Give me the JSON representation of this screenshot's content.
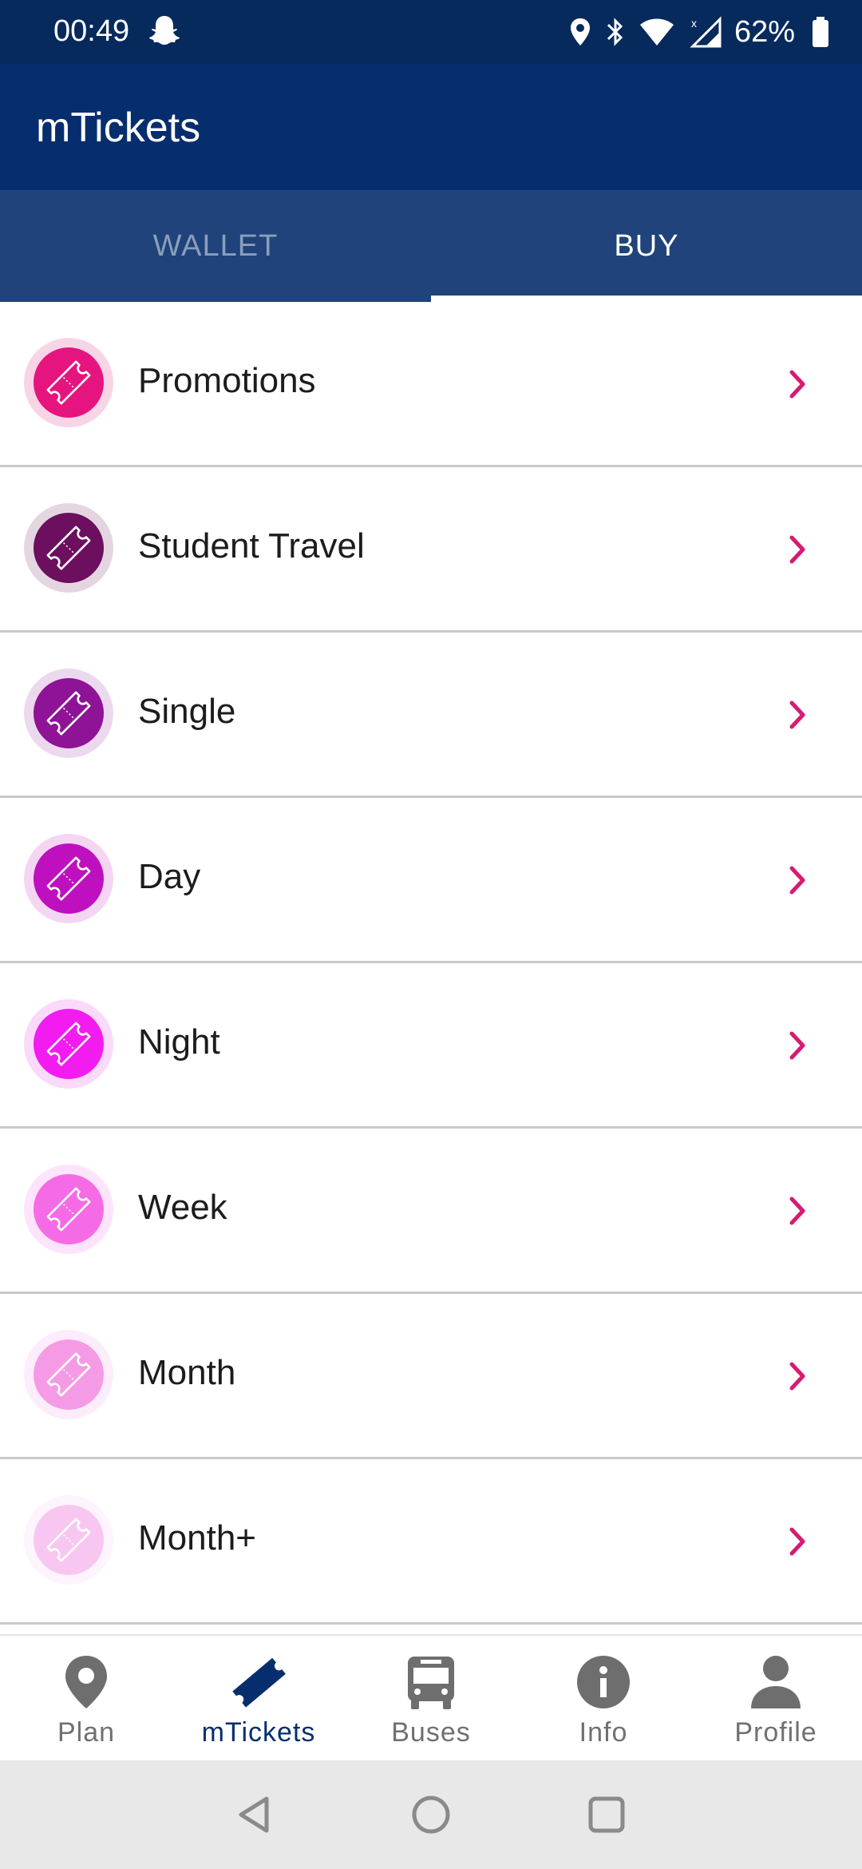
{
  "status_bar": {
    "time": "00:49",
    "battery": "62%",
    "icons": [
      "snapchat-ghost-icon",
      "location-icon",
      "bluetooth-icon",
      "wifi-icon",
      "cell-signal-icon",
      "battery-icon"
    ]
  },
  "app_bar": {
    "title": "mTickets"
  },
  "tabs": [
    {
      "label": "WALLET",
      "active": false
    },
    {
      "label": "BUY",
      "active": true
    }
  ],
  "ticket_categories": [
    {
      "label": "Promotions",
      "color": "#e6147e",
      "halo": "#f7d5e6"
    },
    {
      "label": "Student Travel",
      "color": "#6b0f5e",
      "halo": "#e4d6e1"
    },
    {
      "label": "Single",
      "color": "#8f1396",
      "halo": "#ecd9ee"
    },
    {
      "label": "Day",
      "color": "#bf10c0",
      "halo": "#f4d6f3"
    },
    {
      "label": "Night",
      "color": "#f21cf0",
      "halo": "#fbd9fb"
    },
    {
      "label": "Week",
      "color": "#f56be6",
      "halo": "#fde3fb"
    },
    {
      "label": "Month",
      "color": "#f59be6",
      "halo": "#fdecfb"
    },
    {
      "label": "Month+",
      "color": "#f8c7f1",
      "halo": "#fef4fd"
    }
  ],
  "accent_color": "#d81b72",
  "bottom_nav": [
    {
      "label": "Plan",
      "icon": "map-pin-icon",
      "active": false
    },
    {
      "label": "mTickets",
      "icon": "ticket-icon",
      "active": true
    },
    {
      "label": "Buses",
      "icon": "bus-icon",
      "active": false
    },
    {
      "label": "Info",
      "icon": "info-icon",
      "active": false
    },
    {
      "label": "Profile",
      "icon": "person-icon",
      "active": false
    }
  ]
}
